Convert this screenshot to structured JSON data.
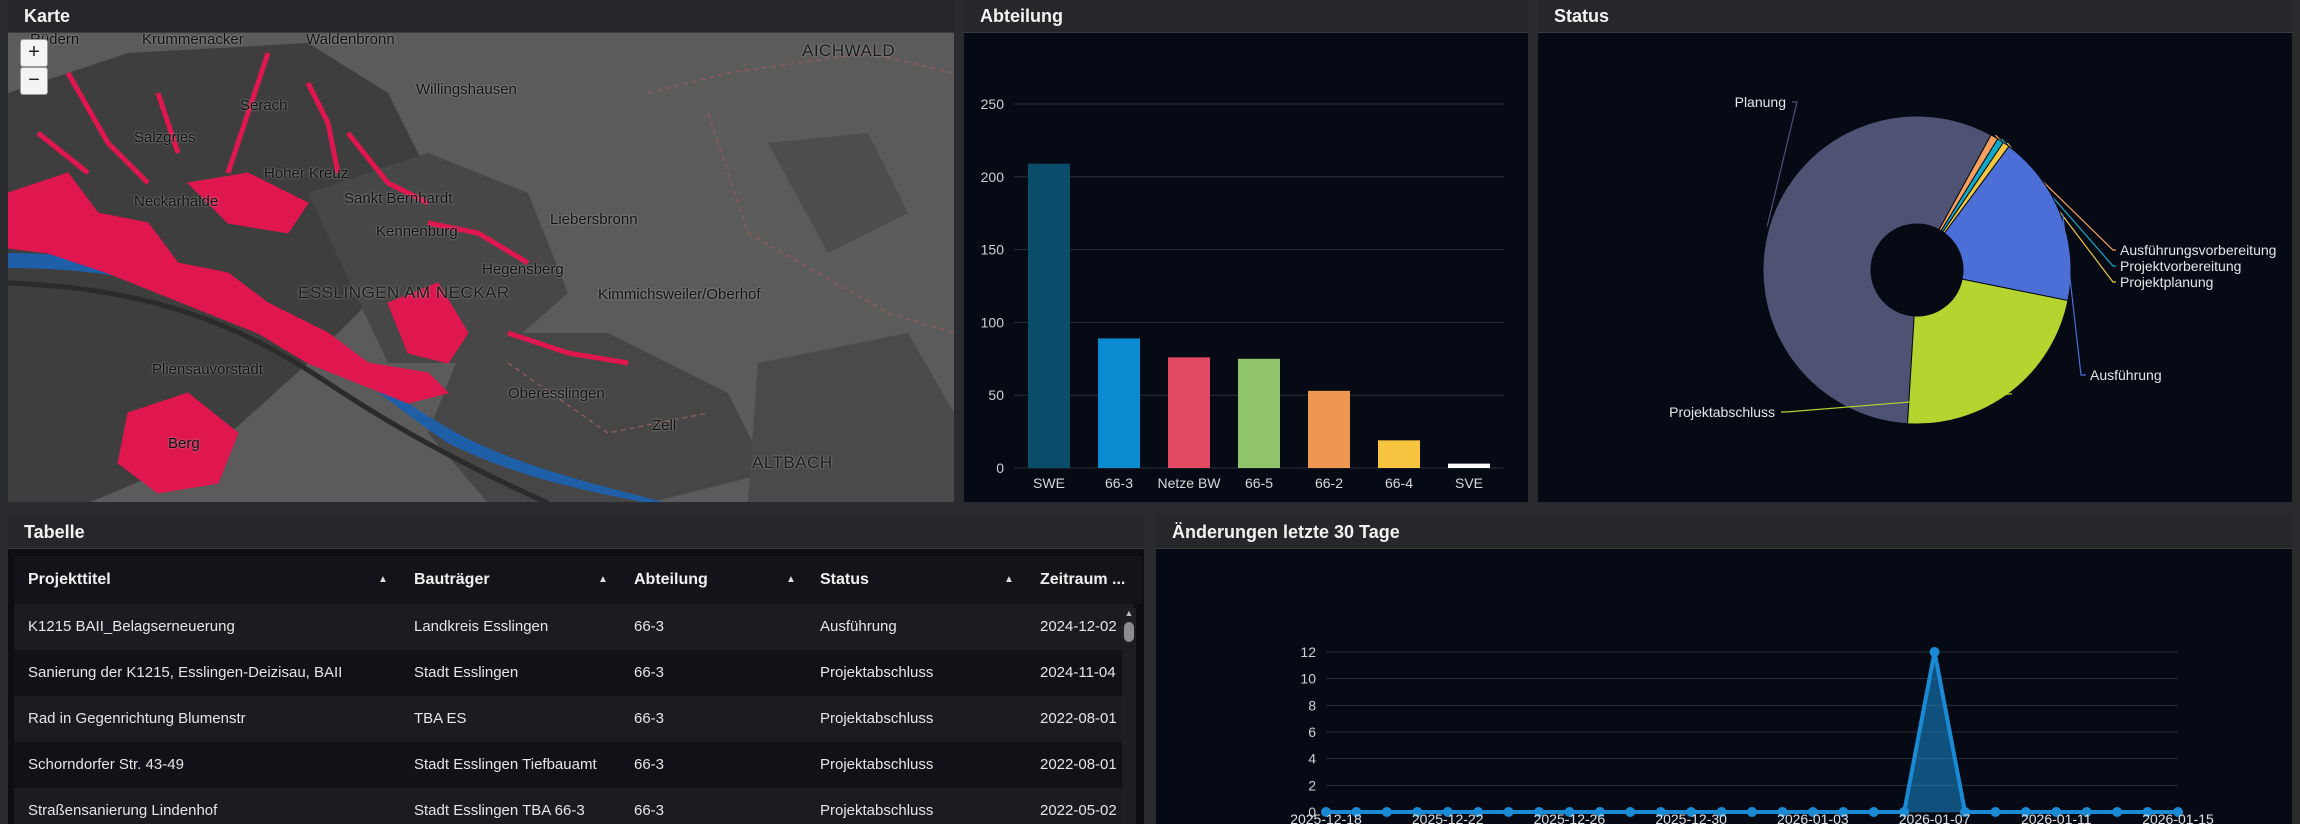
{
  "map": {
    "title": "Karte",
    "zoom_in": "+",
    "zoom_out": "−",
    "places": {
      "ruedern": "Rüdern",
      "krummenacker": "Krummenacker",
      "waldenbronn": "Waldenbronn",
      "aichwald": "AICHWALD",
      "wilhelmshausen": "Willingshausen",
      "serach": "Serach",
      "salzgries": "Salzgries",
      "hoher_kreuz": "Hoher Kreuz",
      "sankt_bernhardt": "Sankt Bernhardt",
      "neckarhalde": "Neckarhalde",
      "kennenburg": "Kennenburg",
      "liebersbronn": "Liebersbronn",
      "hegensberg": "Hegensberg",
      "esslingen": "ESSLINGEN AM NECKAR",
      "kimmichsweiler": "Kimmichsweiler/Oberhof",
      "pliensauvorstadt": "Pliensauvorstadt",
      "oberesslingen": "Oberesslingen",
      "zell": "Zell",
      "altbach": "ALTBACH",
      "berg": "Berg"
    }
  },
  "abteilung": {
    "title": "Abteilung"
  },
  "status": {
    "title": "Status"
  },
  "table": {
    "title": "Tabelle",
    "columns": [
      "Projekttitel",
      "Bauträger",
      "Abteilung",
      "Status",
      "Zeitraum ..."
    ],
    "sort_icon": "▲",
    "rows": [
      [
        "K1215 BAII_Belagserneuerung",
        "Landkreis Esslingen",
        "66-3",
        "Ausführung",
        "2024-12-02"
      ],
      [
        "Sanierung der K1215, Esslingen-Deizisau, BAII",
        "Stadt Esslingen",
        "66-3",
        "Projektabschluss",
        "2024-11-04"
      ],
      [
        "Rad in Gegenrichtung Blumenstr",
        "TBA ES",
        "66-3",
        "Projektabschluss",
        "2022-08-01"
      ],
      [
        "Schorndorfer Str. 43-49",
        "Stadt Esslingen Tiefbauamt",
        "66-3",
        "Projektabschluss",
        "2022-08-01"
      ],
      [
        "Straßensanierung Lindenhof",
        "Stadt Esslingen TBA 66-3",
        "66-3",
        "Projektabschluss",
        "2022-05-02"
      ]
    ]
  },
  "changes": {
    "title": "Änderungen letzte 30 Tage"
  },
  "chart_data": [
    {
      "type": "bar",
      "title": "Abteilung",
      "categories": [
        "SWE",
        "66-3",
        "Netze BW",
        "66-5",
        "66-2",
        "66-4",
        "SVE"
      ],
      "values": [
        209,
        89,
        76,
        75,
        53,
        19,
        3
      ],
      "colors": [
        "#0a4d6b",
        "#0a8ad0",
        "#e24a63",
        "#8fc46a",
        "#ef9752",
        "#f7c440",
        "#ffffff"
      ],
      "ylim": [
        0,
        250
      ],
      "yticks": [
        0,
        50,
        100,
        150,
        200,
        250
      ],
      "grid": true
    },
    {
      "type": "pie",
      "title": "Status",
      "donut": true,
      "slices": [
        {
          "label": "Planung",
          "value": 57,
          "color": "#4e5273"
        },
        {
          "label": "Ausführungsvorbereitung",
          "value": 0.8,
          "color": "#f5a05e"
        },
        {
          "label": "Projektvorbereitung",
          "value": 0.7,
          "color": "#14a8c7"
        },
        {
          "label": "Projektplanung",
          "value": 0.7,
          "color": "#f0c640"
        },
        {
          "label": "Ausführung",
          "value": 18,
          "color": "#4b6fd6"
        },
        {
          "label": "Projektabschluss",
          "value": 22.8,
          "color": "#b5d430"
        }
      ]
    },
    {
      "type": "area",
      "title": "Änderungen letzte 30 Tage",
      "x": [
        "2025-12-18",
        "2025-12-19",
        "2025-12-20",
        "2025-12-21",
        "2025-12-22",
        "2025-12-23",
        "2025-12-24",
        "2025-12-25",
        "2025-12-26",
        "2025-12-27",
        "2025-12-28",
        "2025-12-29",
        "2025-12-30",
        "2025-12-31",
        "2026-01-01",
        "2026-01-02",
        "2026-01-03",
        "2026-01-04",
        "2026-01-05",
        "2026-01-06",
        "2026-01-07",
        "2026-01-08",
        "2026-01-09",
        "2026-01-10",
        "2026-01-11",
        "2026-01-12",
        "2026-01-13",
        "2026-01-14",
        "2026-01-15"
      ],
      "values": [
        0,
        0,
        0,
        0,
        0,
        0,
        0,
        0,
        0,
        0,
        0,
        0,
        0,
        0,
        0,
        0,
        0,
        0,
        0,
        0,
        12,
        0,
        0,
        0,
        0,
        0,
        0,
        0,
        0
      ],
      "xtick_labels": [
        "2025-12-18",
        "2025-12-22",
        "2025-12-26",
        "2025-12-30",
        "2026-01-03",
        "2026-01-07",
        "2026-01-11",
        "2026-01-15"
      ],
      "ylim": [
        0,
        12
      ],
      "yticks": [
        0,
        2,
        4,
        6,
        8,
        10,
        12
      ],
      "color": "#1a8ad4",
      "grid": true
    }
  ]
}
